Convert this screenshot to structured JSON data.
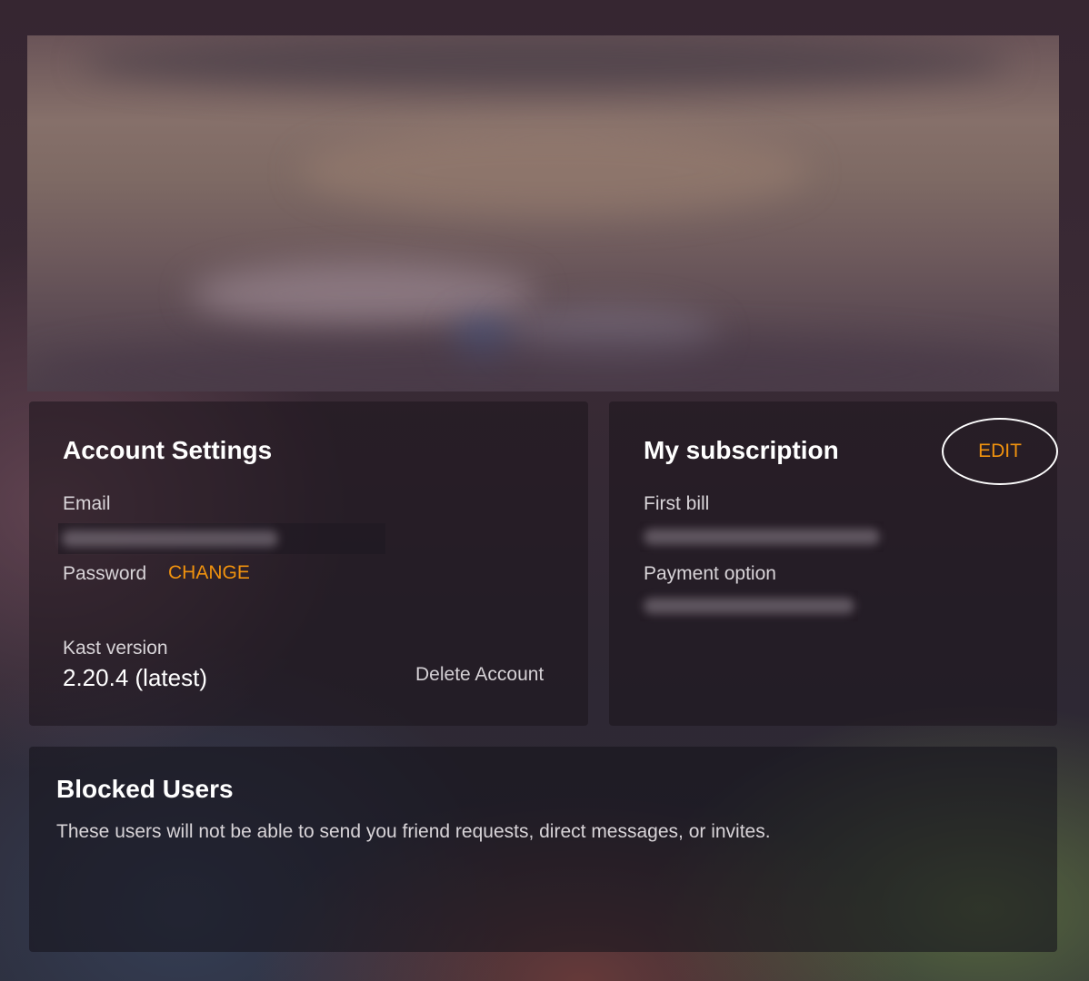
{
  "account": {
    "title": "Account Settings",
    "email_label": "Email",
    "password_label": "Password",
    "change_label": "CHANGE",
    "version_label": "Kast version",
    "version_value": "2.20.4 (latest)",
    "delete_label": "Delete Account"
  },
  "subscription": {
    "title": "My subscription",
    "edit_label": "EDIT",
    "first_bill_label": "First bill",
    "payment_option_label": "Payment option"
  },
  "blocked": {
    "title": "Blocked Users",
    "description": "These users will not be able to send you friend requests, direct messages, or invites."
  },
  "colors": {
    "accent": "#f0920e",
    "text": "#ffffff",
    "muted": "#d8d4d8"
  }
}
